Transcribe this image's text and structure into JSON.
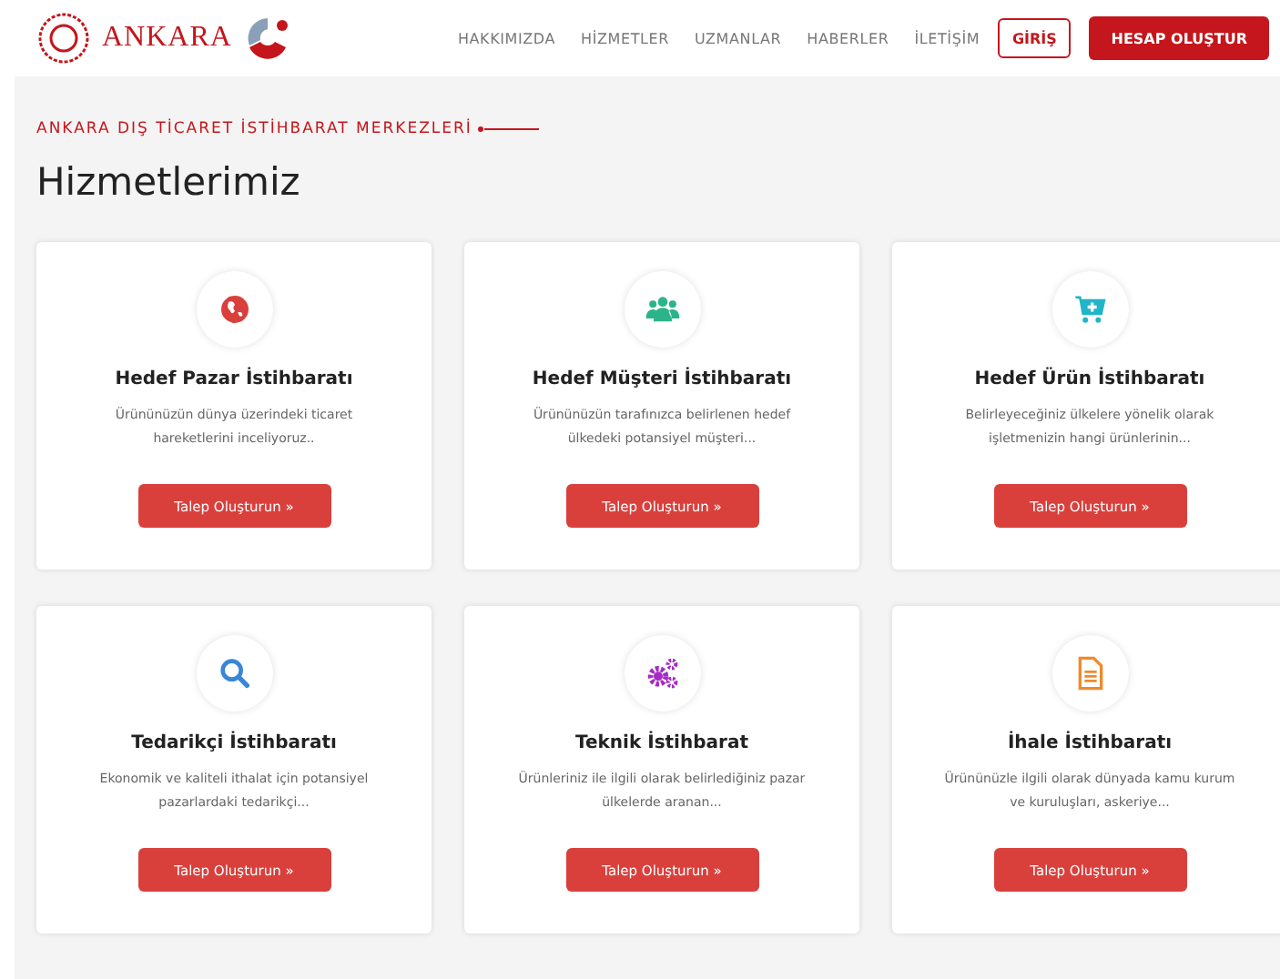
{
  "header": {
    "logo_text": "ANKARA",
    "nav": [
      "HAKKIMIZDA",
      "HİZMETLER",
      "UZMANLAR",
      "HABERLER",
      "İLETİŞİM"
    ],
    "login": "GİRİŞ",
    "signup": "HESAP OLUŞTUR"
  },
  "section": {
    "eyebrow": "ANKARA DIŞ TİCARET İSTİHBARAT MERKEZLERİ",
    "title": "Hizmetlerimiz"
  },
  "cards": [
    {
      "kind": "globe",
      "color": "#d9403c",
      "title": "Hedef Pazar İstihbaratı",
      "text": "Ürününüzün dünya üzerindeki ticaret hareketlerini inceliyoruz..",
      "button": "Talep Oluşturun »"
    },
    {
      "kind": "users",
      "color": "#2bb48a",
      "title": "Hedef Müşteri İstihbaratı",
      "text": "Ürününüzün tarafınızca belirlenen hedef ülkedeki potansiyel müşteri...",
      "button": "Talep Oluşturun »"
    },
    {
      "kind": "cart",
      "color": "#20b5c8",
      "title": "Hedef Ürün İstihbaratı",
      "text": "Belirleyeceğiniz ülkelere yönelik olarak işletmenizin hangi ürünlerinin...",
      "button": "Talep Oluşturun »"
    },
    {
      "kind": "search",
      "color": "#3a86d4",
      "title": "Tedarikçi İstihbaratı",
      "text": "Ekonomik ve kaliteli ithalat için potansiyel pazarlardaki tedarikçi...",
      "button": "Talep Oluşturun »"
    },
    {
      "kind": "gears",
      "color": "#a62bc2",
      "title": "Teknik İstihbarat",
      "text": "Ürünleriniz ile ilgili olarak belirlediğiniz pazar ülkelerde aranan...",
      "button": "Talep Oluşturun »"
    },
    {
      "kind": "document",
      "color": "#ef8a2c",
      "title": "İhale İstihbaratı",
      "text": "Ürününüzle ilgili olarak dünyada kamu kurum ve kuruluşları, askeriye...",
      "button": "Talep Oluşturun »"
    }
  ]
}
